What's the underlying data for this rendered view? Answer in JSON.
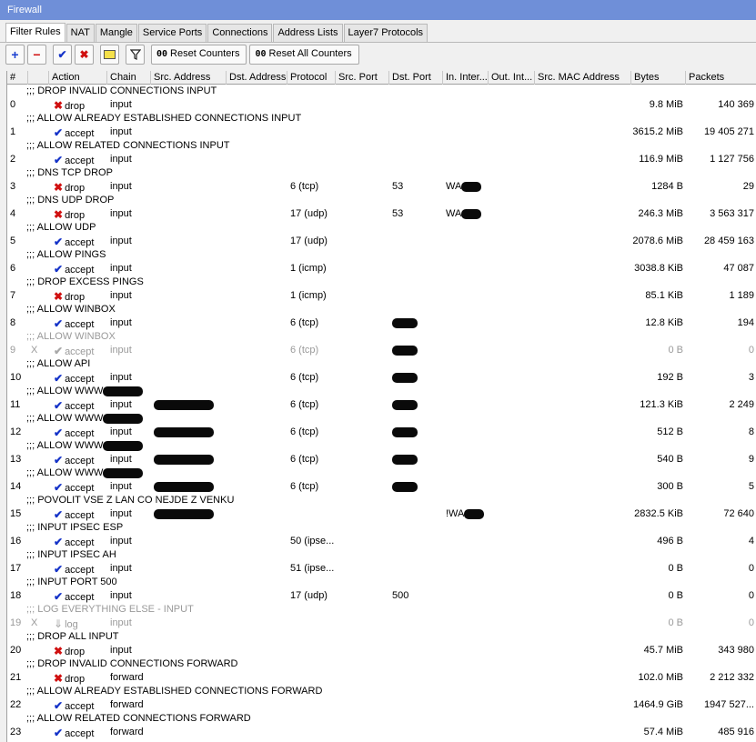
{
  "window": {
    "title": "Firewall"
  },
  "tabs": [
    "Filter Rules",
    "NAT",
    "Mangle",
    "Service Ports",
    "Connections",
    "Address Lists",
    "Layer7 Protocols"
  ],
  "toolbar": {
    "add": "+",
    "remove": "−",
    "enable": "✔",
    "disable": "✖",
    "comment": "",
    "filter": "",
    "reset_counters": "Reset Counters",
    "reset_all_counters": "Reset All Counters",
    "counter_icon": "00"
  },
  "columns": [
    "#",
    "",
    "Action",
    "Chain",
    "Src. Address",
    "Dst. Address",
    "Protocol",
    "Src. Port",
    "Dst. Port",
    "In. Inter...",
    "Out. Int...",
    "Src. MAC Address",
    "Bytes",
    "Packets"
  ],
  "rules": [
    {
      "comment": ";;; DROP INVALID CONNECTIONS INPUT",
      "num": "0",
      "disabled": false,
      "action": "drop",
      "icon": "x-icon",
      "chain": "input",
      "protocol": "",
      "dst_port": "",
      "in_iface": "",
      "bytes": "9.8 MiB",
      "packets": "140 369"
    },
    {
      "comment": ";;; ALLOW ALREADY ESTABLISHED CONNECTIONS INPUT",
      "num": "1",
      "disabled": false,
      "action": "accept",
      "icon": "check-icon",
      "chain": "input",
      "protocol": "",
      "dst_port": "",
      "in_iface": "",
      "bytes": "3615.2 MiB",
      "packets": "19 405 271"
    },
    {
      "comment": ";;; ALLOW RELATED CONNECTIONS INPUT",
      "num": "2",
      "disabled": false,
      "action": "accept",
      "icon": "check-icon",
      "chain": "input",
      "protocol": "",
      "dst_port": "",
      "in_iface": "",
      "bytes": "116.9 MiB",
      "packets": "1 127 756"
    },
    {
      "comment": ";;; DNS TCP DROP",
      "num": "3",
      "disabled": false,
      "action": "drop",
      "icon": "x-icon",
      "chain": "input",
      "protocol": "6 (tcp)",
      "dst_port": "53",
      "in_iface": "WA",
      "redact_in": true,
      "bytes": "1284 B",
      "packets": "29"
    },
    {
      "comment": ";;; DNS UDP DROP",
      "num": "4",
      "disabled": false,
      "action": "drop",
      "icon": "x-icon",
      "chain": "input",
      "protocol": "17 (udp)",
      "dst_port": "53",
      "in_iface": "WA",
      "redact_in": true,
      "bytes": "246.3 MiB",
      "packets": "3 563 317"
    },
    {
      "comment": ";;; ALLOW UDP",
      "num": "5",
      "disabled": false,
      "action": "accept",
      "icon": "check-icon",
      "chain": "input",
      "protocol": "17 (udp)",
      "dst_port": "",
      "in_iface": "",
      "bytes": "2078.6 MiB",
      "packets": "28 459 163"
    },
    {
      "comment": ";;; ALLOW PINGS",
      "num": "6",
      "disabled": false,
      "action": "accept",
      "icon": "check-icon",
      "chain": "input",
      "protocol": "1 (icmp)",
      "dst_port": "",
      "in_iface": "",
      "bytes": "3038.8 KiB",
      "packets": "47 087"
    },
    {
      "comment": ";;; DROP EXCESS PINGS",
      "num": "7",
      "disabled": false,
      "action": "drop",
      "icon": "x-icon",
      "chain": "input",
      "protocol": "1 (icmp)",
      "dst_port": "",
      "in_iface": "",
      "bytes": "85.1 KiB",
      "packets": "1 189"
    },
    {
      "comment": ";;; ALLOW WINBOX",
      "num": "8",
      "disabled": false,
      "action": "accept",
      "icon": "check-icon",
      "chain": "input",
      "protocol": "6 (tcp)",
      "dst_port": "",
      "redact_dst": true,
      "in_iface": "",
      "bytes": "12.8 KiB",
      "packets": "194"
    },
    {
      "comment": ";;; ALLOW WINBOX",
      "num": "9",
      "disabled": true,
      "flag": "X",
      "action": "accept",
      "icon": "check-icon",
      "chain": "input",
      "protocol": "6 (tcp)",
      "dst_port": "",
      "redact_dst": true,
      "in_iface": "",
      "bytes": "0 B",
      "packets": "0"
    },
    {
      "comment": ";;; ALLOW API",
      "num": "10",
      "disabled": false,
      "action": "accept",
      "icon": "check-icon",
      "chain": "input",
      "protocol": "6 (tcp)",
      "dst_port": "",
      "redact_dst": true,
      "in_iface": "",
      "bytes": "192 B",
      "packets": "3"
    },
    {
      "comment": ";;; ALLOW WWW",
      "redact_comment": true,
      "num": "11",
      "disabled": false,
      "action": "accept",
      "icon": "check-icon",
      "chain": "input",
      "redact_src": true,
      "protocol": "6 (tcp)",
      "dst_port": "",
      "redact_dst": true,
      "in_iface": "",
      "bytes": "121.3 KiB",
      "packets": "2 249"
    },
    {
      "comment": ";;; ALLOW WWW",
      "redact_comment": true,
      "num": "12",
      "disabled": false,
      "action": "accept",
      "icon": "check-icon",
      "chain": "input",
      "redact_src": true,
      "protocol": "6 (tcp)",
      "dst_port": "",
      "redact_dst": true,
      "in_iface": "",
      "bytes": "512 B",
      "packets": "8"
    },
    {
      "comment": ";;; ALLOW WWW",
      "redact_comment": true,
      "num": "13",
      "disabled": false,
      "action": "accept",
      "icon": "check-icon",
      "chain": "input",
      "redact_src": true,
      "protocol": "6 (tcp)",
      "dst_port": "",
      "redact_dst": true,
      "in_iface": "",
      "bytes": "540 B",
      "packets": "9"
    },
    {
      "comment": ";;; ALLOW WWW",
      "redact_comment": true,
      "num": "14",
      "disabled": false,
      "action": "accept",
      "icon": "check-icon",
      "chain": "input",
      "redact_src": true,
      "protocol": "6 (tcp)",
      "dst_port": "",
      "redact_dst": true,
      "in_iface": "",
      "bytes": "300 B",
      "packets": "5"
    },
    {
      "comment": ";;; POVOLIT VSE Z LAN CO NEJDE Z VENKU",
      "num": "15",
      "disabled": false,
      "action": "accept",
      "icon": "check-icon",
      "chain": "input",
      "redact_src": true,
      "protocol": "",
      "dst_port": "",
      "in_iface": "!WA",
      "redact_in": true,
      "bytes": "2832.5 KiB",
      "packets": "72 640"
    },
    {
      "comment": ";;; INPUT IPSEC ESP",
      "num": "16",
      "disabled": false,
      "action": "accept",
      "icon": "check-icon",
      "chain": "input",
      "protocol": "50 (ipse...",
      "dst_port": "",
      "in_iface": "",
      "bytes": "496 B",
      "packets": "4"
    },
    {
      "comment": ";;; INPUT IPSEC AH",
      "num": "17",
      "disabled": false,
      "action": "accept",
      "icon": "check-icon",
      "chain": "input",
      "protocol": "51 (ipse...",
      "dst_port": "",
      "in_iface": "",
      "bytes": "0 B",
      "packets": "0"
    },
    {
      "comment": ";;; INPUT PORT 500",
      "num": "18",
      "disabled": false,
      "action": "accept",
      "icon": "check-icon",
      "chain": "input",
      "protocol": "17 (udp)",
      "dst_port": "500",
      "in_iface": "",
      "bytes": "0 B",
      "packets": "0"
    },
    {
      "comment": ";;; LOG EVERYTHING ELSE - INPUT",
      "num": "19",
      "disabled": true,
      "flag": "X",
      "action": "log",
      "icon": "log-icon",
      "chain": "input",
      "protocol": "",
      "dst_port": "",
      "in_iface": "",
      "bytes": "0 B",
      "packets": "0"
    },
    {
      "comment": ";;; DROP ALL INPUT",
      "num": "20",
      "disabled": false,
      "action": "drop",
      "icon": "x-icon",
      "chain": "input",
      "protocol": "",
      "dst_port": "",
      "in_iface": "",
      "bytes": "45.7 MiB",
      "packets": "343 980"
    },
    {
      "comment": ";;; DROP INVALID CONNECTIONS FORWARD",
      "num": "21",
      "disabled": false,
      "action": "drop",
      "icon": "x-icon",
      "chain": "forward",
      "protocol": "",
      "dst_port": "",
      "in_iface": "",
      "bytes": "102.0 MiB",
      "packets": "2 212 332"
    },
    {
      "comment": ";;; ALLOW ALREADY ESTABLISHED CONNECTIONS FORWARD",
      "num": "22",
      "disabled": false,
      "action": "accept",
      "icon": "check-icon",
      "chain": "forward",
      "protocol": "",
      "dst_port": "",
      "in_iface": "",
      "bytes": "1464.9 GiB",
      "packets": "1947 527..."
    },
    {
      "comment": ";;; ALLOW RELATED CONNECTIONS FORWARD",
      "num": "23",
      "disabled": false,
      "action": "accept",
      "icon": "check-icon",
      "chain": "forward",
      "protocol": "",
      "dst_port": "",
      "in_iface": "",
      "bytes": "57.4 MiB",
      "packets": "485 916"
    }
  ]
}
